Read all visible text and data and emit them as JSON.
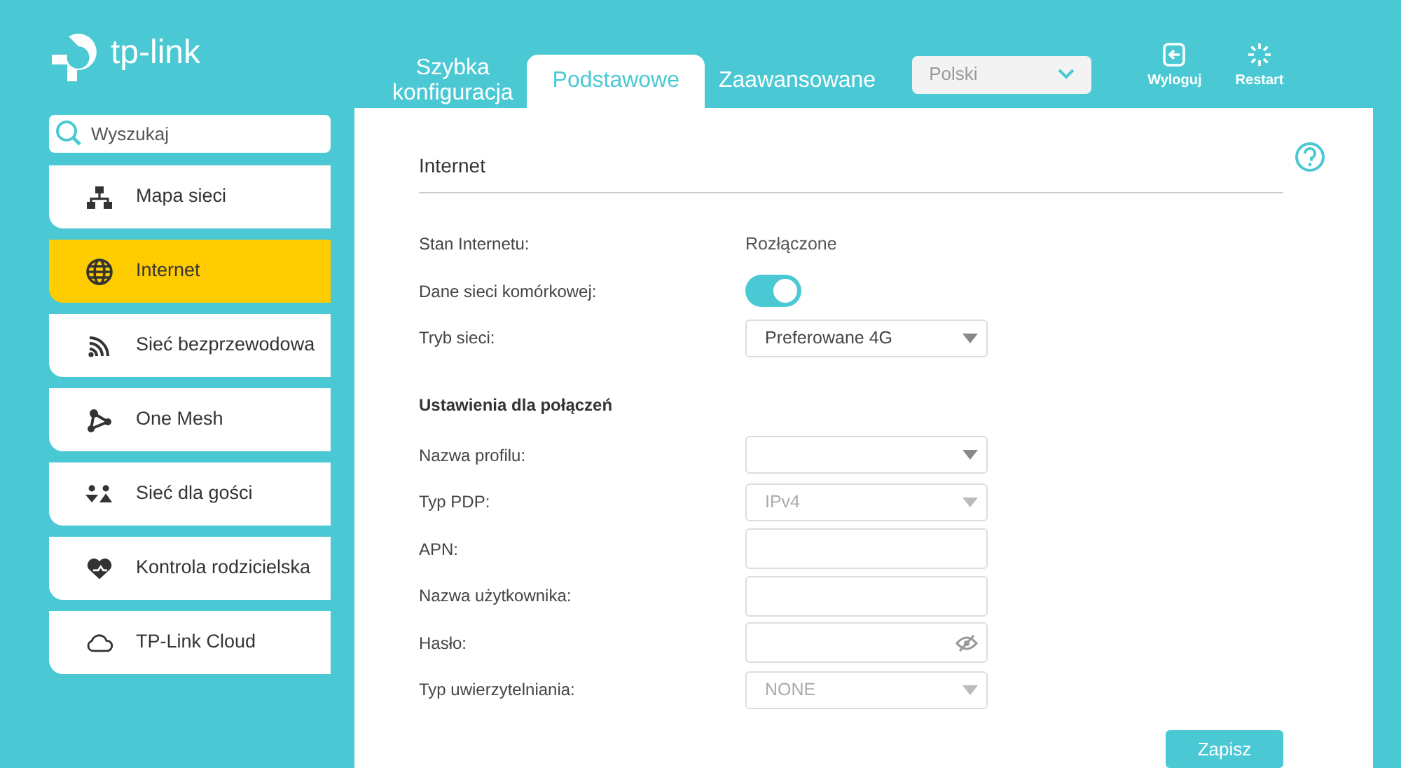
{
  "logo": {
    "text": "tp-link"
  },
  "tabs": [
    {
      "label": "Szybka\nkonfiguracja",
      "selected": false
    },
    {
      "label": "Podstawowe",
      "selected": true
    },
    {
      "label": "Zaawansowane",
      "selected": false
    }
  ],
  "language": {
    "value": "Polski"
  },
  "header_buttons": [
    {
      "label": "Wyloguj"
    },
    {
      "label": "Restart"
    }
  ],
  "search": {
    "placeholder": "Wyszukaj"
  },
  "sidebar": {
    "items": [
      {
        "label": "Mapa sieci",
        "selected": false
      },
      {
        "label": "Internet",
        "selected": true
      },
      {
        "label": "Sieć bezprzewodowa",
        "selected": false
      },
      {
        "label": "One Mesh",
        "selected": false
      },
      {
        "label": "Sieć dla gości",
        "selected": false
      },
      {
        "label": "Kontrola rodzicielska",
        "selected": false
      },
      {
        "label": "TP-Link Cloud",
        "selected": false
      }
    ]
  },
  "panel": {
    "title": "Internet",
    "rows": [
      {
        "kind": "text",
        "label": "Stan Internetu:",
        "value": "Rozłączone"
      },
      {
        "kind": "toggle",
        "label": "Dane sieci komórkowej:",
        "on": true
      },
      {
        "kind": "select",
        "label": "Tryb sieci:",
        "value": "Preferowane 4G",
        "disabled": false
      },
      {
        "kind": "heading",
        "label": "Ustawienia dla połączeń"
      },
      {
        "kind": "select",
        "label": "Nazwa profilu:",
        "disabled": false
      },
      {
        "kind": "select",
        "label": "Typ PDP:",
        "value": "IPv4",
        "disabled": true
      },
      {
        "kind": "input",
        "label": "APN:"
      },
      {
        "kind": "input",
        "label": "Nazwa użytkownika:"
      },
      {
        "kind": "password",
        "label": "Hasło:"
      },
      {
        "kind": "select",
        "label": "Typ uwierzytelniania:",
        "value": "NONE",
        "disabled": true
      }
    ],
    "save_button": "Zapisz"
  }
}
